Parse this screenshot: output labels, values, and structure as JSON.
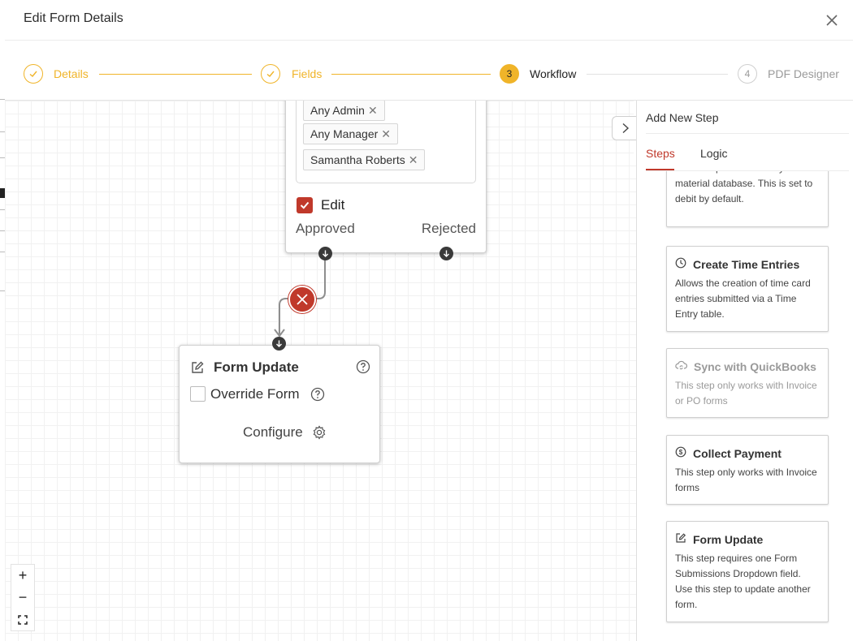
{
  "modal": {
    "title": "Edit Form Details"
  },
  "stepper": {
    "steps": [
      {
        "label": "Details",
        "state": "done"
      },
      {
        "label": "Fields",
        "state": "done"
      },
      {
        "number": "3",
        "label": "Workflow",
        "state": "active"
      },
      {
        "number": "4",
        "label": "PDF Designer",
        "state": "todo"
      }
    ]
  },
  "approval_node": {
    "assignees": [
      "Any Admin",
      "Any Manager",
      "Samantha Roberts"
    ],
    "edit_label": "Edit",
    "edit_checked": true,
    "approved_label": "Approved",
    "rejected_label": "Rejected"
  },
  "form_update_node": {
    "title": "Form Update",
    "override_label": "Override Form",
    "override_checked": false,
    "configure_label": "Configure"
  },
  "zoom": {
    "in": "+",
    "out": "−",
    "fit": "⛶"
  },
  "panel": {
    "title": "Add New Step",
    "tabs": [
      "Steps",
      "Logic"
    ],
    "active_tab": "Steps",
    "cards": [
      {
        "title": "",
        "desc": "material quantities from your material database. This is set to debit by default.",
        "icon": "partial",
        "enabled": true
      },
      {
        "title": "Create Time Entries",
        "desc": "Allows the creation of time card entries submitted via a Time Entry table.",
        "icon": "clock-icon",
        "enabled": true
      },
      {
        "title": "Sync with QuickBooks",
        "desc": "This step only works with Invoice or PO forms",
        "icon": "cloud-sync-icon",
        "enabled": false
      },
      {
        "title": "Collect Payment",
        "desc": "This step only works with Invoice forms",
        "icon": "dollar-icon",
        "enabled": true
      },
      {
        "title": "Form Update",
        "desc": "This step requires one Form Submissions Dropdown field. Use this step to update another form.",
        "icon": "edit-icon",
        "enabled": true
      }
    ]
  },
  "colors": {
    "accent": "#f0b429",
    "danger": "#c0392b"
  }
}
